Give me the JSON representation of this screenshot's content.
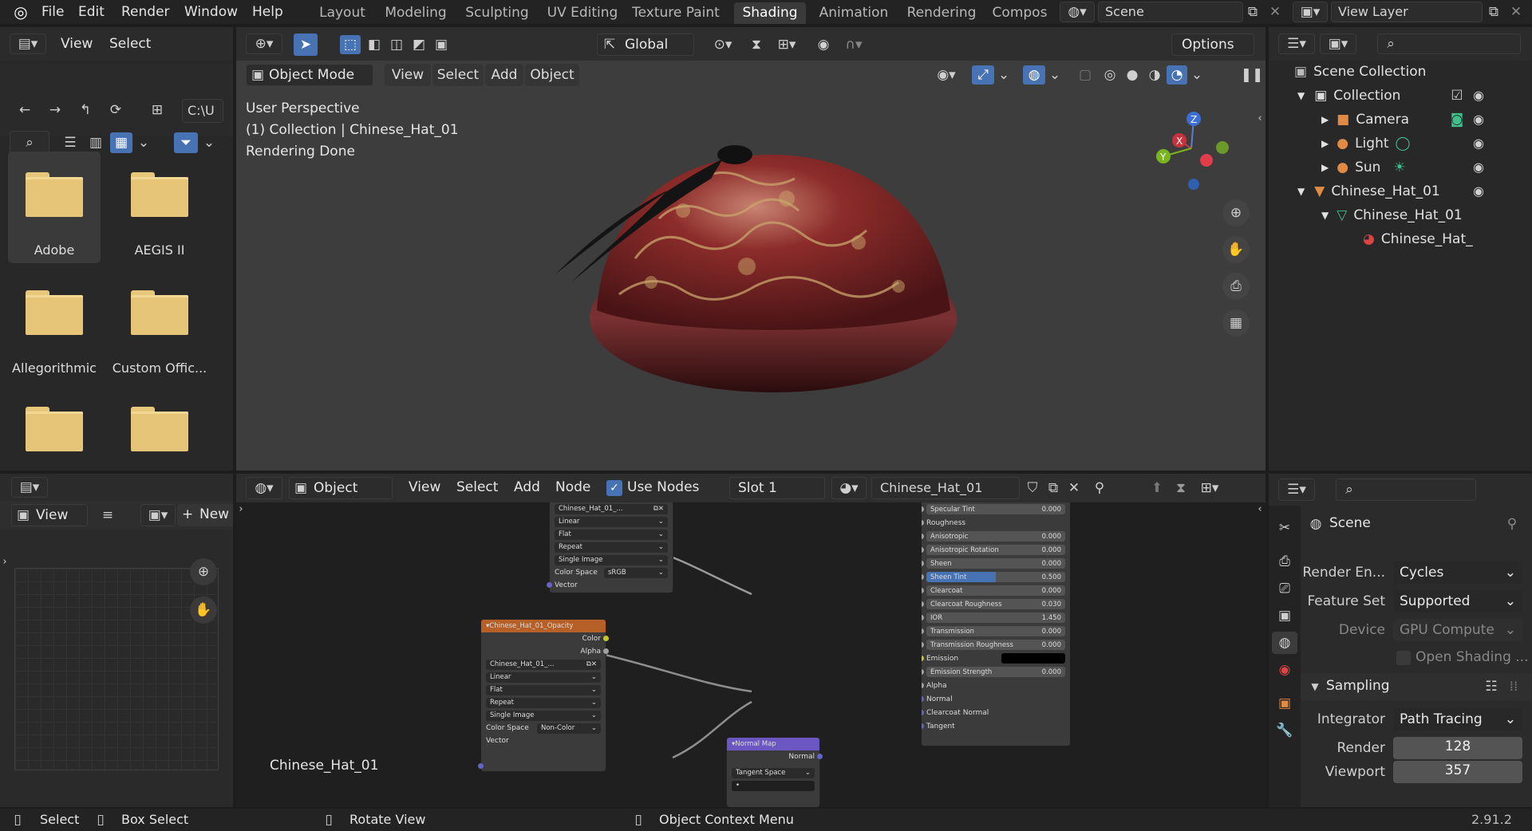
{
  "topmenu": [
    "File",
    "Edit",
    "Render",
    "Window",
    "Help"
  ],
  "workspaces": [
    "Layout",
    "Modeling",
    "Sculpting",
    "UV Editing",
    "Texture Paint",
    "Shading",
    "Animation",
    "Rendering",
    "Compos"
  ],
  "active_workspace": "Shading",
  "scene_name": "Scene",
  "view_layer": "View Layer",
  "filebrowser": {
    "menu": [
      "View",
      "Select"
    ],
    "path": "C:\\U",
    "folders": [
      "Adobe",
      "AEGIS II",
      "Allegorithmic",
      "Custom Offic...",
      "",
      ""
    ]
  },
  "viewport": {
    "mode": "Object Mode",
    "menus": [
      "View",
      "Select",
      "Add",
      "Object"
    ],
    "transform": "Global",
    "options": "Options",
    "info": [
      "User Perspective",
      "(1) Collection | Chinese_Hat_01",
      "Rendering Done"
    ],
    "axes": {
      "x": "X",
      "y": "Y",
      "z": "Z"
    }
  },
  "outliner": {
    "root": "Scene Collection",
    "items": [
      {
        "label": "Collection"
      },
      {
        "label": "Camera"
      },
      {
        "label": "Light"
      },
      {
        "label": "Sun"
      },
      {
        "label": "Chinese_Hat_01"
      },
      {
        "label": "Chinese_Hat_01"
      },
      {
        "label": "Chinese_Hat_"
      }
    ]
  },
  "image_editor": {
    "view": "View",
    "new": "New"
  },
  "node_editor": {
    "object": "Object",
    "menus": [
      "View",
      "Select",
      "Add",
      "Node"
    ],
    "use_nodes": "Use Nodes",
    "slot": "Slot 1",
    "material": "Chinese_Hat_01",
    "label": "Chinese_Hat_01",
    "tex1": {
      "image": "Chinese_Hat_01_...",
      "interp": "Linear",
      "proj": "Flat",
      "ext": "Repeat",
      "source": "Single Image",
      "cs_label": "Color Space",
      "cs": "sRGB",
      "vector": "Vector"
    },
    "tex2": {
      "title": "Chinese_Hat_01_Opacity",
      "color": "Color",
      "alpha": "Alpha",
      "image": "Chinese_Hat_01_...",
      "interp": "Linear",
      "proj": "Flat",
      "ext": "Repeat",
      "source": "Single Image",
      "cs_label": "Color Space",
      "cs": "Non-Color",
      "vector": "Vector"
    },
    "normal": {
      "title": "Normal Map",
      "out": "Normal",
      "space": "Tangent Space",
      "uv": "•"
    },
    "bsdf": [
      {
        "label": "Specular Tint",
        "value": "0.000"
      },
      {
        "label": "Roughness",
        "value": ""
      },
      {
        "label": "Anisotropic",
        "value": "0.000"
      },
      {
        "label": "Anisotropic Rotation",
        "value": "0.000"
      },
      {
        "label": "Sheen",
        "value": "0.000"
      },
      {
        "label": "Sheen Tint",
        "value": "0.500"
      },
      {
        "label": "Clearcoat",
        "value": "0.000"
      },
      {
        "label": "Clearcoat Roughness",
        "value": "0.030"
      },
      {
        "label": "IOR",
        "value": "1.450"
      },
      {
        "label": "Transmission",
        "value": "0.000"
      },
      {
        "label": "Transmission Roughness",
        "value": "0.000"
      },
      {
        "label": "Emission",
        "value": ""
      },
      {
        "label": "Emission Strength",
        "value": "0.000"
      },
      {
        "label": "Alpha",
        "value": ""
      },
      {
        "label": "Normal",
        "value": ""
      },
      {
        "label": "Clearcoat Normal",
        "value": ""
      },
      {
        "label": "Tangent",
        "value": ""
      }
    ]
  },
  "properties": {
    "scene": "Scene",
    "render_engine_label": "Render En...",
    "render_engine": "Cycles",
    "feature_set_label": "Feature Set",
    "feature_set": "Supported",
    "device_label": "Device",
    "device": "GPU Compute",
    "open_shading": "Open Shading ...",
    "sampling": "Sampling",
    "integrator_label": "Integrator",
    "integrator": "Path Tracing",
    "render_label": "Render",
    "render": "128",
    "viewport_label": "Viewport",
    "viewport": "357"
  },
  "statusbar": {
    "select": "Select",
    "box": "Box Select",
    "rotate": "Rotate View",
    "context": "Object Context Menu",
    "version": "2.91.2"
  }
}
